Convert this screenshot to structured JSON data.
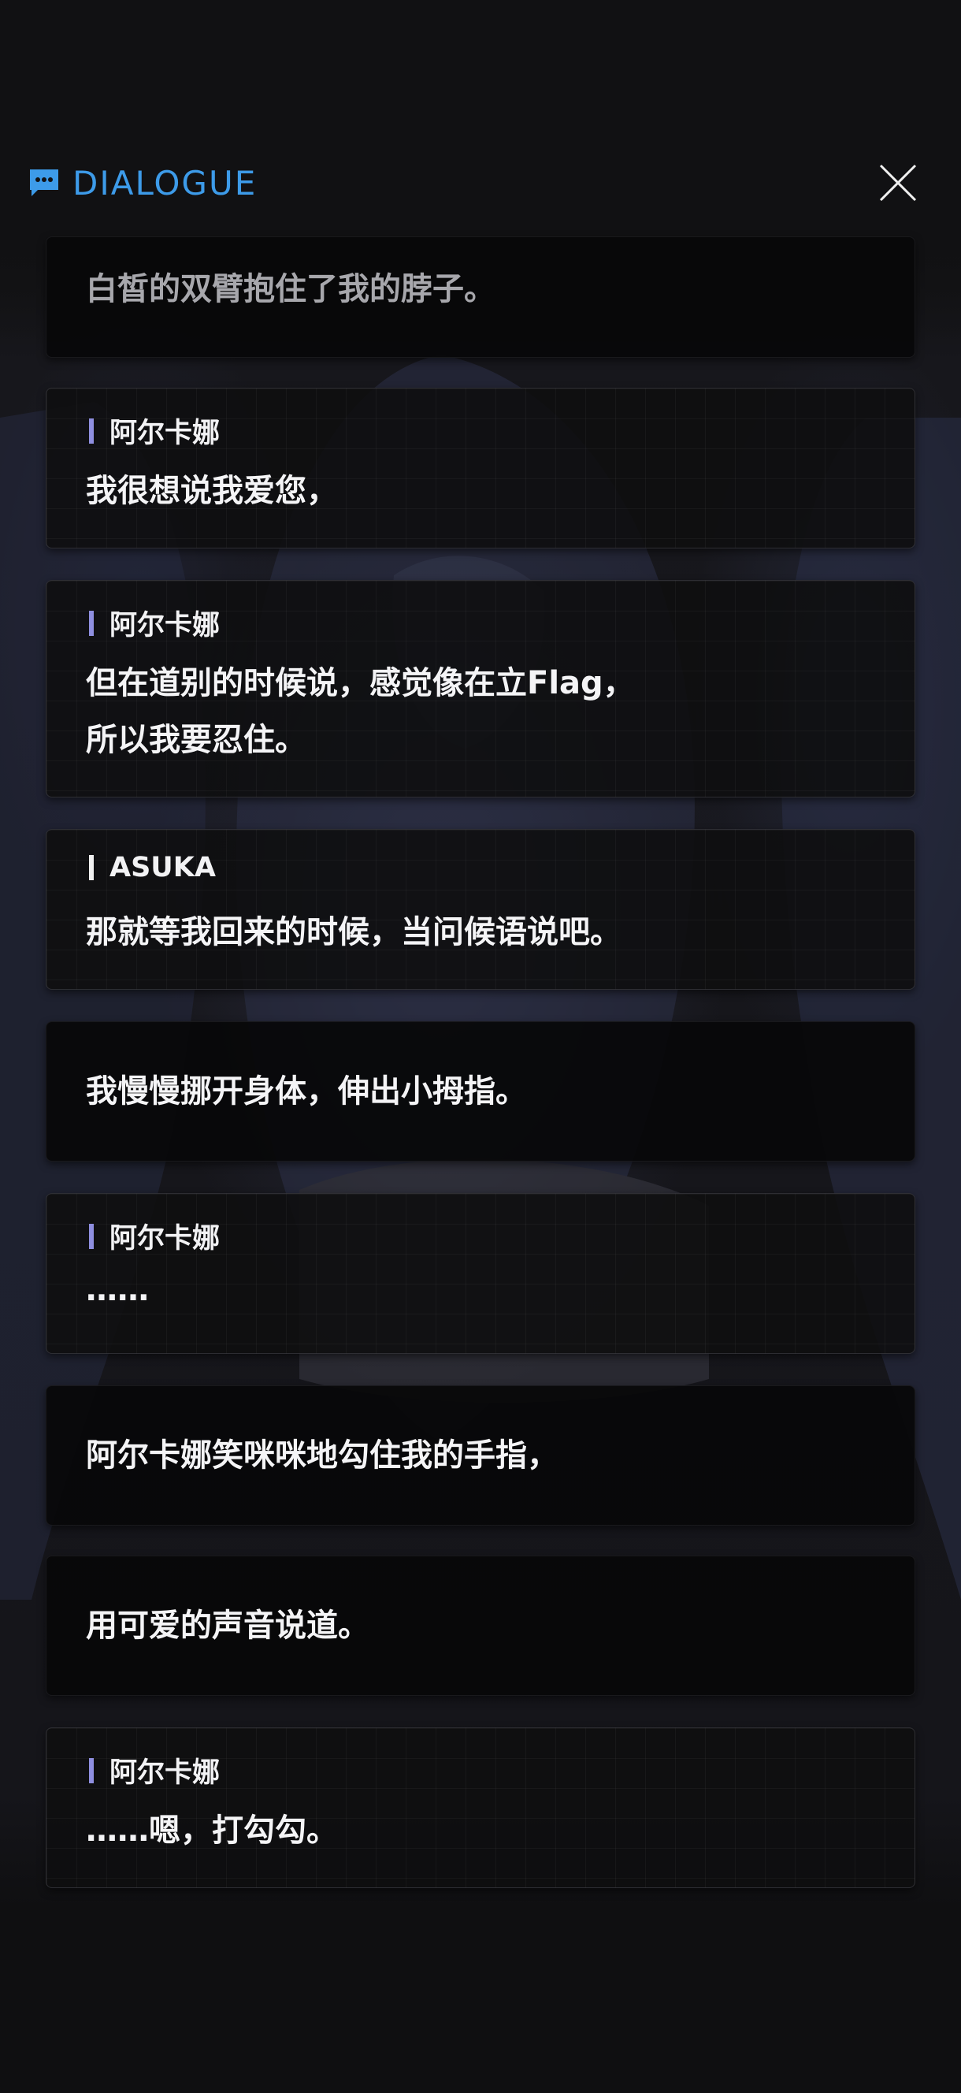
{
  "header": {
    "title": "DIALOGUE",
    "title_color": "#3d9be9",
    "icon": "chat-bubble-icon",
    "close_icon": "close-icon"
  },
  "entries": [
    {
      "speaker": "",
      "lines": [
        "白皙的双臂抱住了我的脖子。"
      ]
    },
    {
      "speaker": "阿尔卡娜",
      "lines": [
        "我很想说我爱您，"
      ]
    },
    {
      "speaker": "阿尔卡娜",
      "lines": [
        "但在道别的时候说，感觉像在立Flag，",
        "所以我要忍住。"
      ]
    },
    {
      "speaker": "ASUKA",
      "lines": [
        "那就等我回来的时候，当问候语说吧。"
      ]
    },
    {
      "speaker": "",
      "lines": [
        "我慢慢挪开身体，伸出小拇指。"
      ]
    },
    {
      "speaker": "阿尔卡娜",
      "lines": [
        "……"
      ]
    },
    {
      "speaker": "",
      "lines": [
        "阿尔卡娜笑咪咪地勾住我的手指，"
      ]
    },
    {
      "speaker": "",
      "lines": [
        "用可爱的声音说道。"
      ]
    },
    {
      "speaker": "阿尔卡娜",
      "lines": [
        "……嗯，打勾勾。"
      ]
    }
  ],
  "colors": {
    "speaker_bar_character": "#8f8fe0",
    "speaker_bar_player": "#f0f0f0"
  }
}
